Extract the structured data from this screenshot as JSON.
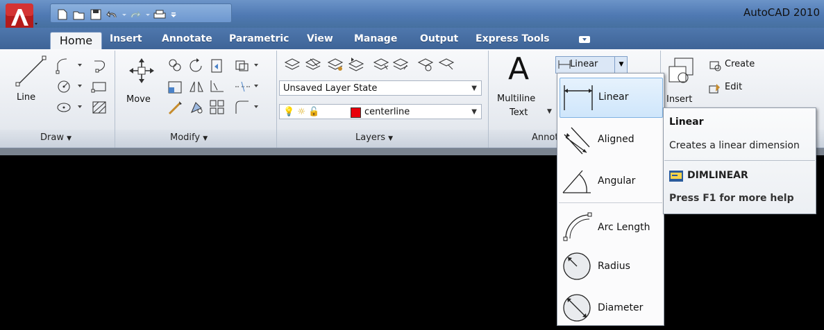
{
  "window": {
    "title": "AutoCAD 2010"
  },
  "tabs": [
    {
      "label": "Home",
      "active": true
    },
    {
      "label": "Insert"
    },
    {
      "label": "Annotate"
    },
    {
      "label": "Parametric"
    },
    {
      "label": "View"
    },
    {
      "label": "Manage"
    },
    {
      "label": "Output"
    },
    {
      "label": "Express Tools"
    }
  ],
  "ribbon": {
    "draw": {
      "line_label": "Line",
      "panel_label": "Draw"
    },
    "modify": {
      "move_label": "Move",
      "panel_label": "Modify"
    },
    "layers": {
      "layer_state": "Unsaved Layer State",
      "current_layer": "centerline",
      "layer_color": "#e8000b",
      "panel_label": "Layers"
    },
    "annotation": {
      "multiline_text_label": [
        "Multiline",
        "Text"
      ],
      "linear_dropdown_label": "Linear",
      "panel_label": "Annotation"
    },
    "block": {
      "insert_label": "Insert",
      "create_label": "Create",
      "edit_label": "Edit"
    }
  },
  "dimension_menu": {
    "items": [
      {
        "label": "Linear",
        "icon": "linear-dimension-icon",
        "highlighted": true
      },
      {
        "label": "Aligned",
        "icon": "aligned-dimension-icon"
      },
      {
        "label": "Angular",
        "icon": "angular-dimension-icon"
      },
      {
        "label": "Arc Length",
        "icon": "arc-length-dimension-icon"
      },
      {
        "label": "Radius",
        "icon": "radius-dimension-icon"
      },
      {
        "label": "Diameter",
        "icon": "diameter-dimension-icon"
      }
    ]
  },
  "tooltip": {
    "title": "Linear",
    "description": "Creates a linear dimension",
    "command": "DIMLINEAR",
    "help": "Press F1 for more help"
  },
  "colors": {
    "titlebar": "#5a85bd",
    "ribbon": "#eef1f5",
    "highlight": "#cfe6fb",
    "canvas": "#000000"
  }
}
